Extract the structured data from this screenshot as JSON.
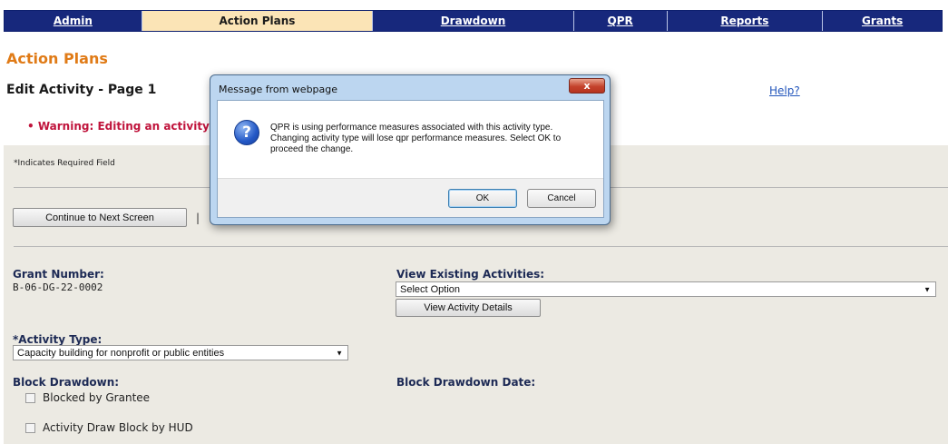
{
  "nav": {
    "items": [
      {
        "label": "Admin",
        "active": false
      },
      {
        "label": "Action Plans",
        "active": true
      },
      {
        "label": "Drawdown",
        "active": false
      },
      {
        "label": "QPR",
        "active": false
      },
      {
        "label": "Reports",
        "active": false
      },
      {
        "label": "Grants",
        "active": false
      }
    ]
  },
  "page": {
    "title": "Action Plans",
    "subtitle": "Edit Activity - Page 1",
    "help_link": "Help?",
    "warning": "•  Warning: Editing an activity",
    "required_note": "*Indicates Required Field"
  },
  "form": {
    "continue_button": "Continue to Next Screen",
    "separator": "|",
    "grant_number_label": "Grant Number:",
    "grant_number_value": "B-06-DG-22-0002",
    "view_existing_label": "View Existing Activities:",
    "view_existing_selected": "Select Option",
    "view_details_button": "View Activity Details",
    "activity_type_label": "*Activity Type:",
    "activity_type_selected": "Capacity building for nonprofit or public entities",
    "block_drawdown_label": "Block Drawdown:",
    "block_drawdown_date_label": "Block Drawdown Date:",
    "checkboxes": [
      {
        "label": "Blocked by Grantee",
        "checked": false
      },
      {
        "label": "Activity Draw Block by HUD",
        "checked": false
      }
    ]
  },
  "dialog": {
    "title": "Message from webpage",
    "close_glyph": "x",
    "icon": "question-icon",
    "icon_glyph": "?",
    "message": "QPR is using performance measures associated with this activity type. Changing activity type will lose qpr performance measures. Select OK to proceed the change.",
    "ok_label": "OK",
    "cancel_label": "Cancel"
  },
  "colors": {
    "nav_bg": "#17287c",
    "nav_active_bg": "#fbe4b6",
    "title_orange": "#e07b17",
    "warning_red": "#c0143c",
    "link_blue": "#2255bb",
    "form_bg": "#eceae3"
  }
}
